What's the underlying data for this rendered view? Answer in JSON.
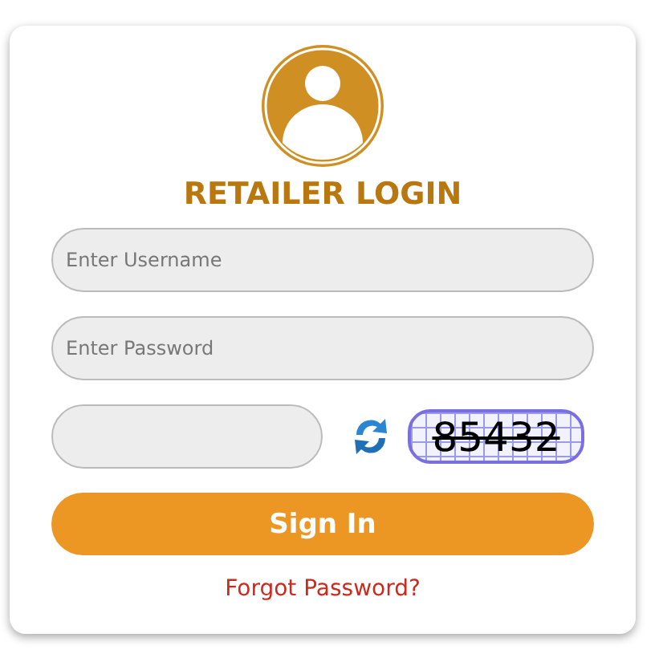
{
  "title": "RETAILER LOGIN",
  "username": {
    "placeholder": "Enter Username"
  },
  "password": {
    "placeholder": "Enter Password"
  },
  "captcha": {
    "code": "85432"
  },
  "sign_in": "Sign In",
  "forgot": "Forgot Password?"
}
